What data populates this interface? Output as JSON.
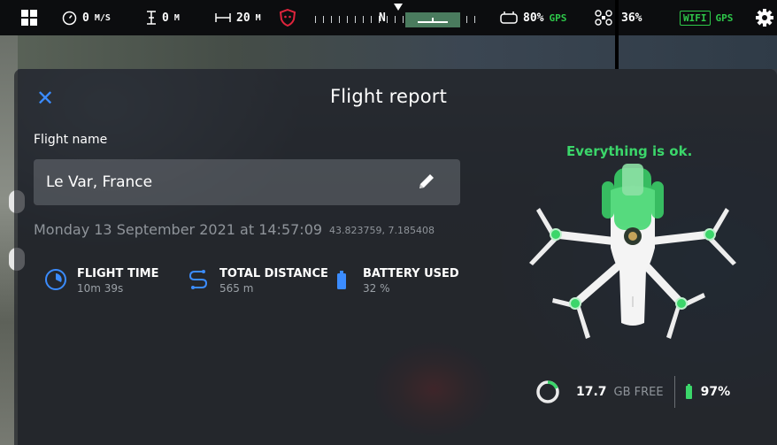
{
  "topbar": {
    "speed": "0",
    "speed_unit": "M/S",
    "altitude": "0",
    "altitude_unit": "M",
    "distance": "20",
    "distance_unit": "M",
    "compass_label": "N",
    "controller_battery": "80%",
    "gps_label": "GPS",
    "drone_battery": "36%",
    "wifi_label": "WIFI",
    "gps2_label": "GPS"
  },
  "dialog": {
    "title": "Flight report",
    "flight_name_label": "Flight name",
    "flight_name_value": "Le Var, France",
    "date": "Monday 13 September 2021 at 14:57:09",
    "coordinates": "43.823759, 7.185408",
    "stats": [
      {
        "label": "FLIGHT TIME",
        "value": "10m 39s",
        "icon": "timer-icon"
      },
      {
        "label": "TOTAL DISTANCE",
        "value": "565 m",
        "icon": "route-icon"
      },
      {
        "label": "BATTERY USED",
        "value": "32 %",
        "icon": "battery-icon"
      }
    ],
    "status_message": "Everything is ok.",
    "storage_value": "17.7",
    "storage_unit": "GB FREE",
    "battery_level": "97%"
  },
  "colors": {
    "accent": "#3b8cff",
    "ok_green": "#3bd66a",
    "gps_green": "#2ec84a",
    "warning_red": "#e0243c"
  }
}
